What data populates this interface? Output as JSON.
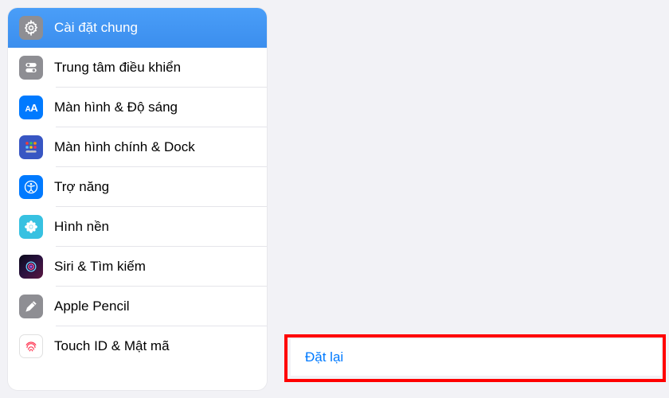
{
  "sidebar": {
    "items": [
      {
        "id": "general",
        "label": "Cài đặt chung",
        "icon": "gear-icon",
        "selected": true
      },
      {
        "id": "control",
        "label": "Trung tâm điều khiển",
        "icon": "toggles-icon",
        "selected": false
      },
      {
        "id": "display",
        "label": "Màn hình & Độ sáng",
        "icon": "text-size-icon",
        "selected": false
      },
      {
        "id": "home",
        "label": "Màn hình chính & Dock",
        "icon": "app-grid-icon",
        "selected": false
      },
      {
        "id": "accessibility",
        "label": "Trợ năng",
        "icon": "accessibility-icon",
        "selected": false
      },
      {
        "id": "wallpaper",
        "label": "Hình nền",
        "icon": "flower-icon",
        "selected": false
      },
      {
        "id": "siri",
        "label": "Siri & Tìm kiếm",
        "icon": "siri-icon",
        "selected": false
      },
      {
        "id": "pencil",
        "label": "Apple Pencil",
        "icon": "pencil-icon",
        "selected": false
      },
      {
        "id": "touchid",
        "label": "Touch ID & Mật mã",
        "icon": "fingerprint-icon",
        "selected": false
      }
    ]
  },
  "detail": {
    "reset_label": "Đặt lại"
  },
  "colors": {
    "accent": "#007aff",
    "highlight_border": "#ff0000"
  }
}
